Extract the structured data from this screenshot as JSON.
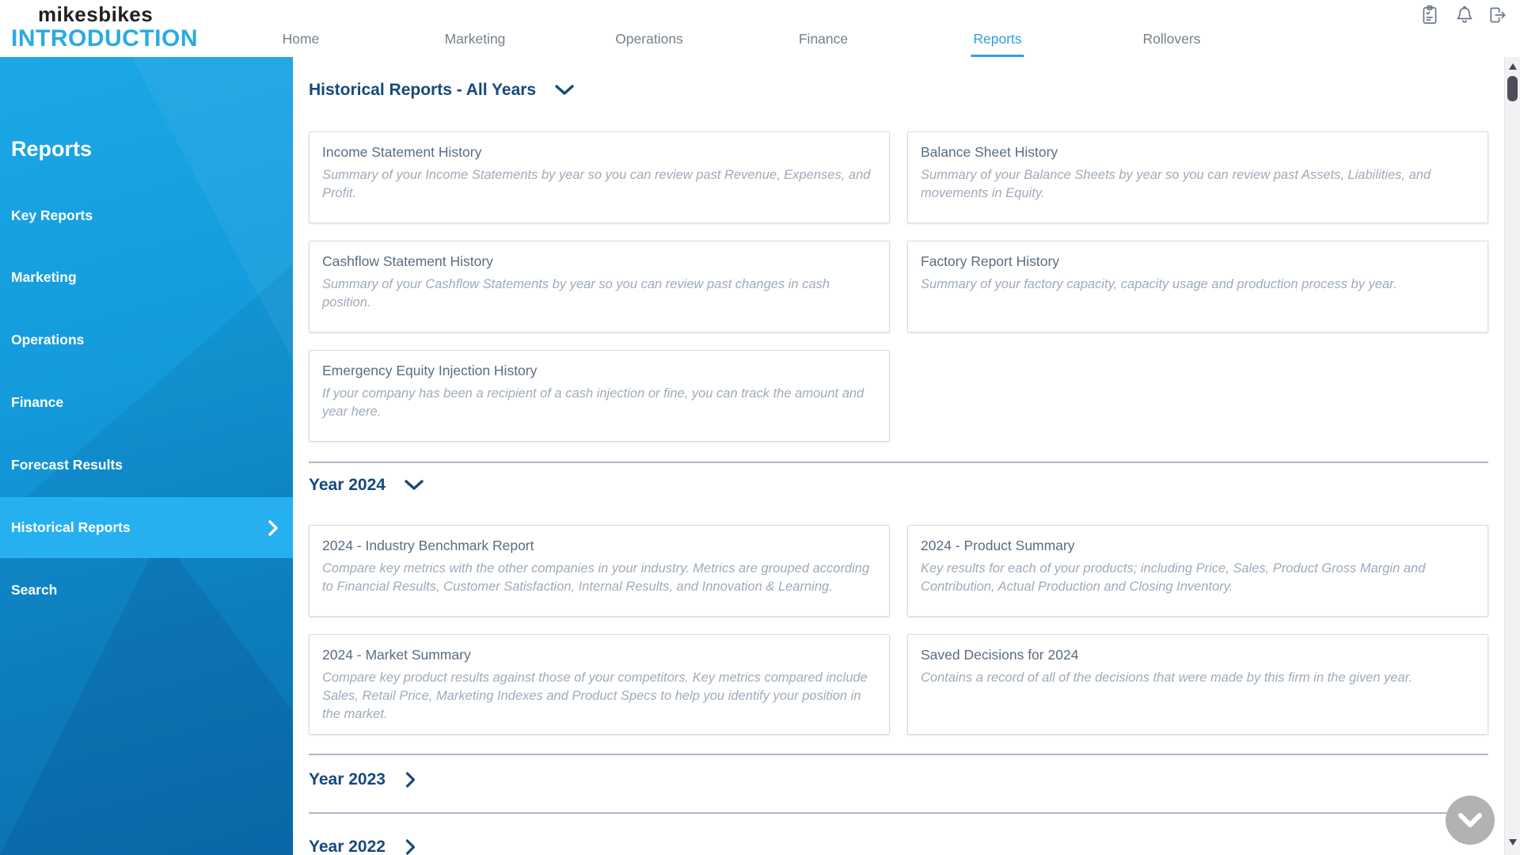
{
  "logo": {
    "line1": "mikesbikes",
    "line2": "INTRODUCTION"
  },
  "nav": {
    "items": [
      {
        "label": "Home",
        "active": false
      },
      {
        "label": "Marketing",
        "active": false
      },
      {
        "label": "Operations",
        "active": false
      },
      {
        "label": "Finance",
        "active": false
      },
      {
        "label": "Reports",
        "active": true
      },
      {
        "label": "Rollovers",
        "active": false
      }
    ]
  },
  "header_icons": [
    {
      "name": "tasks-clipboard-icon"
    },
    {
      "name": "notifications-bell-icon"
    },
    {
      "name": "sign-out-icon"
    }
  ],
  "sidebar": {
    "heading": "Reports",
    "items": [
      {
        "label": "Key Reports",
        "active": false
      },
      {
        "label": "Marketing",
        "active": false
      },
      {
        "label": "Operations",
        "active": false
      },
      {
        "label": "Finance",
        "active": false
      },
      {
        "label": "Forecast Results",
        "active": false
      },
      {
        "label": "Historical Reports",
        "active": true
      },
      {
        "label": "Search",
        "active": false
      }
    ]
  },
  "content": {
    "sections": [
      {
        "title": "Historical Reports - All Years",
        "state": "expanded",
        "cards": [
          {
            "title": "Income Statement History",
            "desc": "Summary of your Income Statements by year so you can review past Revenue, Expenses, and Profit."
          },
          {
            "title": "Balance Sheet History",
            "desc": "Summary of your Balance Sheets by year so you can review past Assets, Liabilities, and movements in Equity."
          },
          {
            "title": "Cashflow Statement History",
            "desc": "Summary of your Cashflow Statements by year so you can review past changes in cash position."
          },
          {
            "title": "Factory Report History",
            "desc": "Summary of your factory capacity, capacity usage and production process by year."
          },
          {
            "title": "Emergency Equity Injection History",
            "desc": "If your company has been a recipient of a cash injection or fine, you can track the amount and year here."
          }
        ]
      },
      {
        "title": "Year 2024",
        "state": "expanded",
        "cards": [
          {
            "title": "2024 - Industry Benchmark Report",
            "desc": "Compare key metrics with the other companies in your industry. Metrics are grouped according to Financial Results, Customer Satisfaction, Internal Results, and Innovation & Learning."
          },
          {
            "title": "2024 - Product Summary",
            "desc": "Key results for each of your products; including Price, Sales, Product Gross Margin and Contribution, Actual Production and Closing Inventory."
          },
          {
            "title": "2024 - Market Summary",
            "desc": "Compare key product results against those of your competitors. Key metrics compared include Sales, Retail Price, Marketing Indexes and Product Specs to help you identify your position in the market."
          },
          {
            "title": "Saved Decisions for 2024",
            "desc": "Contains a record of all of the decisions that were made by this firm in the given year."
          }
        ]
      },
      {
        "title": "Year 2023",
        "state": "collapsed"
      },
      {
        "title": "Year 2022",
        "state": "collapsed"
      }
    ]
  },
  "colors": {
    "accent_blue": "#29abe2",
    "nav_active_blue": "#2ea2da",
    "sidebar_top": "#1ba7e6",
    "sidebar_bottom": "#0b76ba",
    "sidebar_active_item": "#27b0f0",
    "heading_navy": "#17497b",
    "card_title": "#5b6d80",
    "card_desc": "#9fabb9",
    "nav_gray": "#75808c",
    "divider": "#aeb8c9",
    "fab_gray": "#b2b2b5"
  }
}
